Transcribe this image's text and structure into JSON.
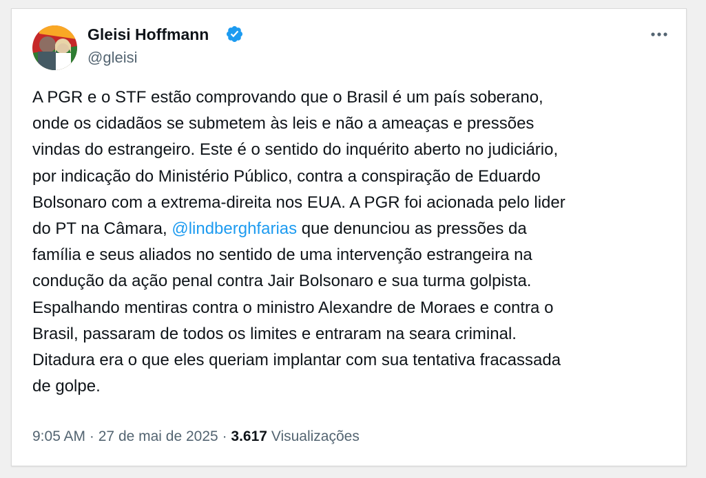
{
  "author": {
    "name": "Gleisi Hoffmann",
    "handle": "@gleisi"
  },
  "icons": {
    "verified": "verified-badge-icon",
    "more": "more-horizontal-icon",
    "avatar": "profile-photo"
  },
  "colors": {
    "verified": "#1d9bf0",
    "link": "#1d9bf0",
    "text": "#0f1419",
    "muted": "#536471"
  },
  "tweet": {
    "lines": [
      "A PGR e o STF estão comprovando que o Brasil é um país soberano,",
      "onde os cidadãos se submetem às leis e não a ameaças e pressões",
      "vindas do estrangeiro. Este é o sentido do inquérito aberto no judiciário,",
      "por indicação do Ministério Público, contra a conspiração de Eduardo",
      "Bolsonaro com a extrema-direita nos EUA. A PGR foi acionada pelo lider",
      "do PT na Câmara, ",
      "@lindberghfarias",
      " que denunciou as pressões da",
      "família e seus aliados no sentido de uma intervenção estrangeira na",
      "condução da ação penal contra Jair Bolsonaro e sua turma golpista.",
      "Espalhando mentiras contra o ministro Alexandre de Moraes e contra o",
      "Brasil, passaram de todos os limites e entraram na seara criminal.",
      "Ditadura era o que eles queriam implantar com sua tentativa fracassada",
      "de golpe."
    ]
  },
  "meta": {
    "time": "9:05 AM",
    "separator": "·",
    "date": "27 de mai de 2025",
    "views_count": "3.617",
    "views_label": "Visualizações"
  }
}
